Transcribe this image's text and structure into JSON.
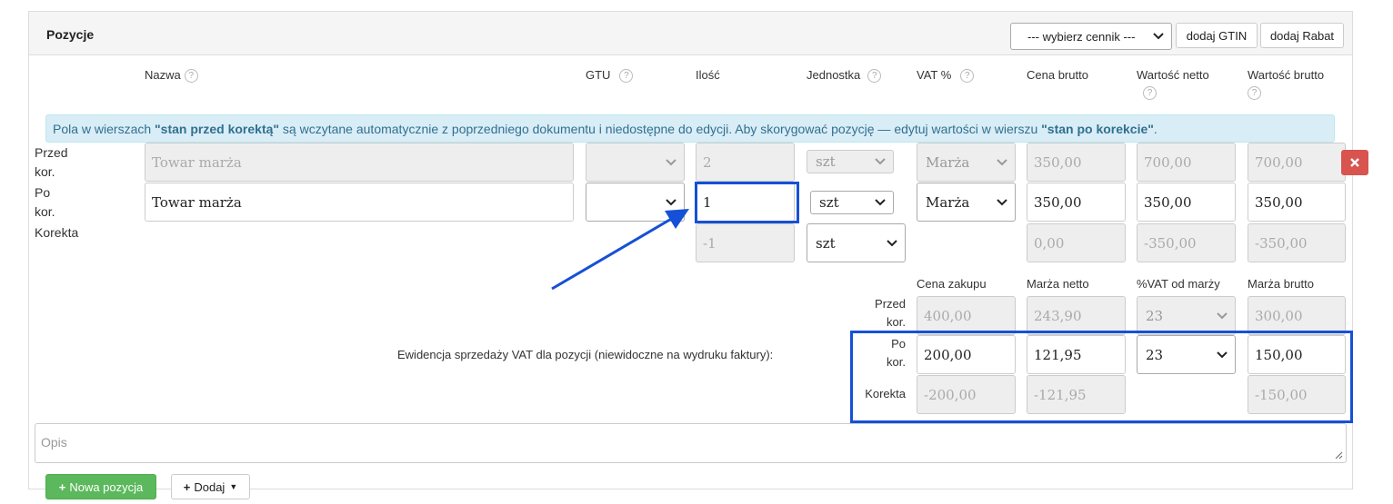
{
  "panel": {
    "title": "Pozycje"
  },
  "toolbar": {
    "pricelist_select": "--- wybierz cennik ---",
    "add_gtin": "dodaj GTIN",
    "add_discount": "dodaj Rabat"
  },
  "columns": {
    "name": "Nazwa",
    "gtu": "GTU",
    "qty": "Ilość",
    "unit": "Jednostka",
    "vat": "VAT %",
    "gross_price": "Cena brutto",
    "net_value": "Wartość netto",
    "gross_value": "Wartość brutto"
  },
  "info": {
    "part1": "Pola w wierszach ",
    "bold1": "\"stan przed korektą\"",
    "part2": " są wczytane automatycznie z poprzedniego dokumentu i niedostępne do edycji. Aby skorygować pozycję — edytuj wartości w wierszu ",
    "bold2": "\"stan po korekcie\"",
    "part3": "."
  },
  "rows": {
    "before": {
      "label_1": "Przed",
      "label_2": "kor.",
      "name": "Towar marża",
      "qty": "2",
      "unit": "szt",
      "vat": "Marża",
      "gross_price": "350,00",
      "net_value": "700,00",
      "gross_value": "700,00"
    },
    "after": {
      "label_1": "Po",
      "label_2": "kor.",
      "name": "Towar marża",
      "qty": "1",
      "unit": "szt",
      "vat": "Marża",
      "gross_price": "350,00",
      "net_value": "350,00",
      "gross_value": "350,00"
    },
    "correction": {
      "label": "Korekta",
      "qty": "-1",
      "unit": "szt",
      "gross_price": "0,00",
      "net_value": "-350,00",
      "gross_value": "-350,00"
    }
  },
  "margin": {
    "columns": {
      "purchase_price": "Cena zakupu",
      "net_margin": "Marża netto",
      "vat_from_margin": "%VAT od marży",
      "gross_margin": "Marża brutto"
    },
    "caption": "Ewidencja sprzedaży VAT dla pozycji (niewidoczne na wydruku faktury):",
    "before": {
      "label_1": "Przed",
      "label_2": "kor.",
      "purchase_price": "400,00",
      "net_margin": "243,90",
      "vat": "23",
      "gross_margin": "300,00"
    },
    "after": {
      "label_1": "Po",
      "label_2": "kor.",
      "purchase_price": "200,00",
      "net_margin": "121,95",
      "vat": "23",
      "gross_margin": "150,00"
    },
    "correction": {
      "label": "Korekta",
      "purchase_price": "-200,00",
      "net_margin": "-121,95",
      "gross_margin": "-150,00"
    }
  },
  "description": {
    "placeholder": "Opis"
  },
  "footer": {
    "new_position": "Nowa pozycja",
    "add": "Dodaj"
  },
  "colors": {
    "highlight": "#1550d6",
    "info_bg": "#d9edf7",
    "success": "#5cb85c",
    "danger": "#d9534f"
  }
}
